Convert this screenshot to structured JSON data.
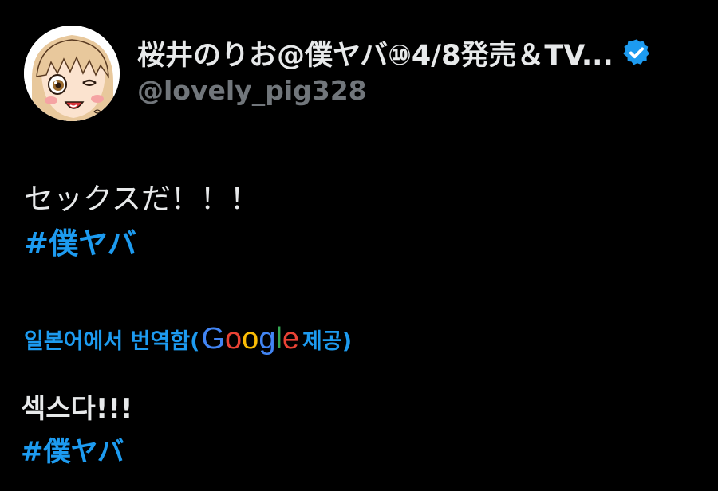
{
  "author": {
    "display_name": "桜井のりお@僕ヤバ⑩4/8発売＆TV...",
    "handle": "@lovely_pig328",
    "verified_icon": "verified-badge-icon",
    "avatar_icon": "avatar-illustration"
  },
  "tweet": {
    "text": "セックスだ！！！",
    "hashtag": "#僕ヤバ"
  },
  "translation": {
    "label_prefix": "일본어에서 번역함(",
    "provider_letters": [
      "G",
      "o",
      "o",
      "g",
      "l",
      "e"
    ],
    "label_suffix": " 제공)",
    "text": "섹스다!!!",
    "hashtag": "#僕ヤバ"
  },
  "colors": {
    "background": "#000000",
    "primary_text": "#e7e9ea",
    "secondary_text": "#71767b",
    "link": "#1d9bf0",
    "google_blue": "#4285f4",
    "google_red": "#ea4335",
    "google_yellow": "#fbbc05",
    "google_green": "#34a853"
  }
}
